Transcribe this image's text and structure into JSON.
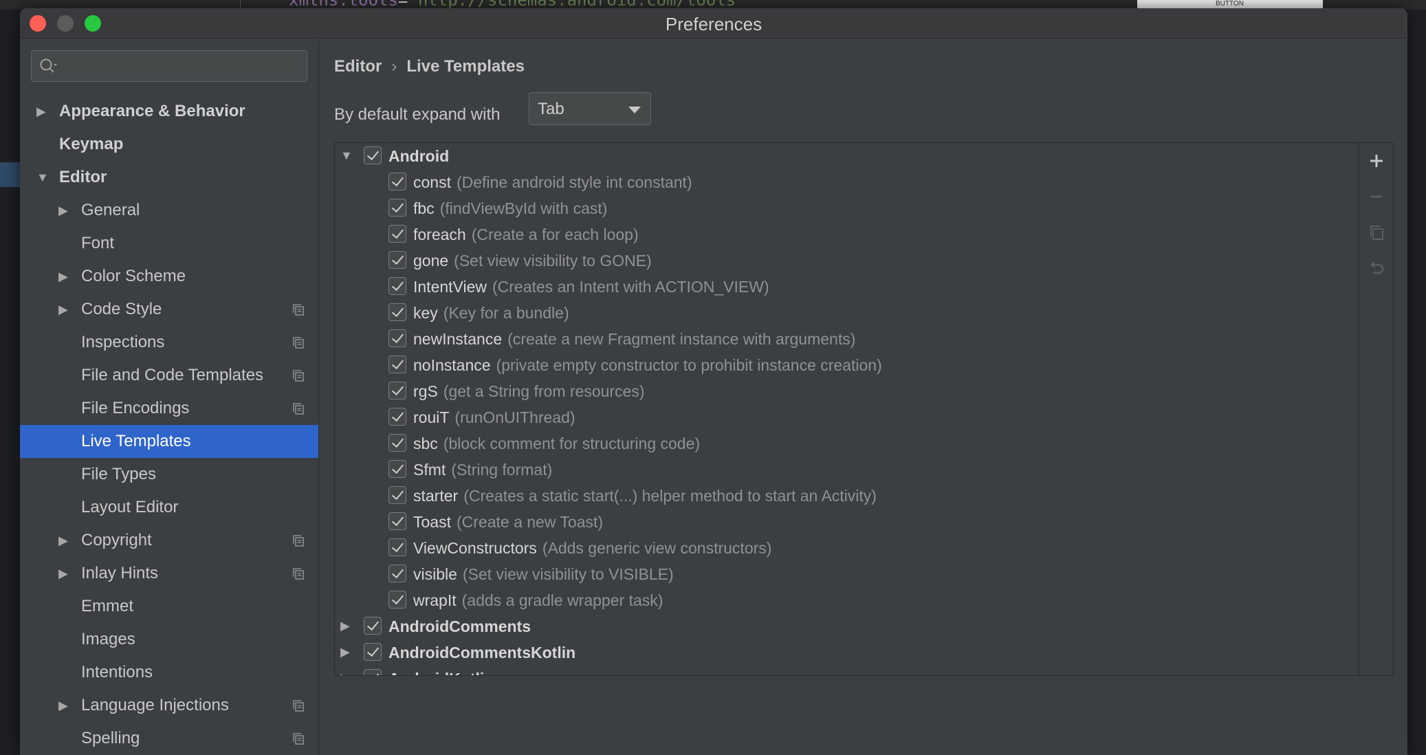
{
  "background": {
    "code_attr": "xmlns:tools",
    "code_value": "\"http://schemas.android.com/tools\"",
    "preview_label": "BUTTON"
  },
  "window": {
    "title": "Preferences"
  },
  "sidebar": {
    "search": {
      "value": "",
      "placeholder": ""
    },
    "items": [
      {
        "label": "Appearance & Behavior",
        "level": 0,
        "arrow": "▶",
        "bold": true,
        "copy": false
      },
      {
        "label": "Keymap",
        "level": 0,
        "arrow": "",
        "bold": true,
        "copy": false
      },
      {
        "label": "Editor",
        "level": 0,
        "arrow": "▼",
        "bold": true,
        "copy": false
      },
      {
        "label": "General",
        "level": 1,
        "arrow": "▶",
        "bold": false,
        "copy": false
      },
      {
        "label": "Font",
        "level": 1,
        "arrow": "",
        "bold": false,
        "copy": false
      },
      {
        "label": "Color Scheme",
        "level": 1,
        "arrow": "▶",
        "bold": false,
        "copy": false
      },
      {
        "label": "Code Style",
        "level": 1,
        "arrow": "▶",
        "bold": false,
        "copy": true
      },
      {
        "label": "Inspections",
        "level": 1,
        "arrow": "",
        "bold": false,
        "copy": true
      },
      {
        "label": "File and Code Templates",
        "level": 1,
        "arrow": "",
        "bold": false,
        "copy": true
      },
      {
        "label": "File Encodings",
        "level": 1,
        "arrow": "",
        "bold": false,
        "copy": true
      },
      {
        "label": "Live Templates",
        "level": 1,
        "arrow": "",
        "bold": false,
        "copy": false,
        "selected": true
      },
      {
        "label": "File Types",
        "level": 1,
        "arrow": "",
        "bold": false,
        "copy": false
      },
      {
        "label": "Layout Editor",
        "level": 1,
        "arrow": "",
        "bold": false,
        "copy": false
      },
      {
        "label": "Copyright",
        "level": 1,
        "arrow": "▶",
        "bold": false,
        "copy": true
      },
      {
        "label": "Inlay Hints",
        "level": 1,
        "arrow": "▶",
        "bold": false,
        "copy": true
      },
      {
        "label": "Emmet",
        "level": 1,
        "arrow": "",
        "bold": false,
        "copy": false
      },
      {
        "label": "Images",
        "level": 1,
        "arrow": "",
        "bold": false,
        "copy": false
      },
      {
        "label": "Intentions",
        "level": 1,
        "arrow": "",
        "bold": false,
        "copy": false
      },
      {
        "label": "Language Injections",
        "level": 1,
        "arrow": "▶",
        "bold": false,
        "copy": true
      },
      {
        "label": "Spelling",
        "level": 1,
        "arrow": "",
        "bold": false,
        "copy": true
      }
    ]
  },
  "main": {
    "breadcrumb": {
      "parent": "Editor",
      "separator": "›",
      "current": "Live Templates"
    },
    "expand": {
      "label": "By default expand with",
      "value": "Tab"
    },
    "toolbar": {
      "add": "+",
      "remove": "−"
    },
    "templates": [
      {
        "group": true,
        "expanded": true,
        "abbr": "Android",
        "desc": ""
      },
      {
        "abbr": "const",
        "desc": "(Define android style int constant)"
      },
      {
        "abbr": "fbc",
        "desc": "(findViewById with cast)"
      },
      {
        "abbr": "foreach",
        "desc": "(Create a for each loop)"
      },
      {
        "abbr": "gone",
        "desc": "(Set view visibility to GONE)"
      },
      {
        "abbr": "IntentView",
        "desc": "(Creates an Intent with ACTION_VIEW)"
      },
      {
        "abbr": "key",
        "desc": "(Key for a bundle)"
      },
      {
        "abbr": "newInstance",
        "desc": "(create a new Fragment instance with arguments)"
      },
      {
        "abbr": "noInstance",
        "desc": "(private empty constructor to prohibit instance creation)"
      },
      {
        "abbr": "rgS",
        "desc": "(get a String from resources)"
      },
      {
        "abbr": "rouiT",
        "desc": "(runOnUIThread)"
      },
      {
        "abbr": "sbc",
        "desc": "(block comment for structuring code)"
      },
      {
        "abbr": "Sfmt",
        "desc": "(String format)"
      },
      {
        "abbr": "starter",
        "desc": "(Creates a static start(...) helper method to start an Activity)"
      },
      {
        "abbr": "Toast",
        "desc": "(Create a new Toast)"
      },
      {
        "abbr": "ViewConstructors",
        "desc": "(Adds generic view constructors)"
      },
      {
        "abbr": "visible",
        "desc": "(Set view visibility to VISIBLE)"
      },
      {
        "abbr": "wrapIt",
        "desc": "(adds a gradle wrapper task)"
      },
      {
        "group": true,
        "expanded": false,
        "abbr": "AndroidComments",
        "desc": ""
      },
      {
        "group": true,
        "expanded": false,
        "abbr": "AndroidCommentsKotlin",
        "desc": ""
      },
      {
        "group": true,
        "expanded": false,
        "abbr": "AndroidKotlin",
        "desc": ""
      }
    ]
  }
}
